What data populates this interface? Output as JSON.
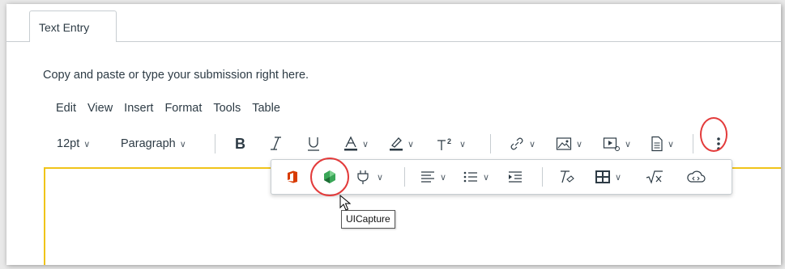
{
  "tabs": [
    {
      "label": "Text Entry"
    }
  ],
  "instructions": "Copy and paste or type your submission right here.",
  "menubar": [
    "Edit",
    "View",
    "Insert",
    "Format",
    "Tools",
    "Table"
  ],
  "toolbar": {
    "font_size": "12pt",
    "block_format": "Paragraph"
  },
  "tooltip": "UICapture",
  "colors": {
    "accent_yellow": "#f0c419",
    "highlight_circle": "#e33b3b",
    "office_red": "#d83b01",
    "uicapture_green": "#3aa657"
  },
  "icons": [
    "bold-icon",
    "italic-icon",
    "underline-icon",
    "text-color-icon",
    "highlight-icon",
    "superscript-icon",
    "link-icon",
    "image-icon",
    "media-icon",
    "document-icon",
    "more-options-icon",
    "office-icon",
    "uicapture-icon",
    "plugin-icon",
    "align-icon",
    "list-icon",
    "indent-icon",
    "clear-format-icon",
    "table-icon",
    "math-icon",
    "cloud-embed-icon"
  ]
}
